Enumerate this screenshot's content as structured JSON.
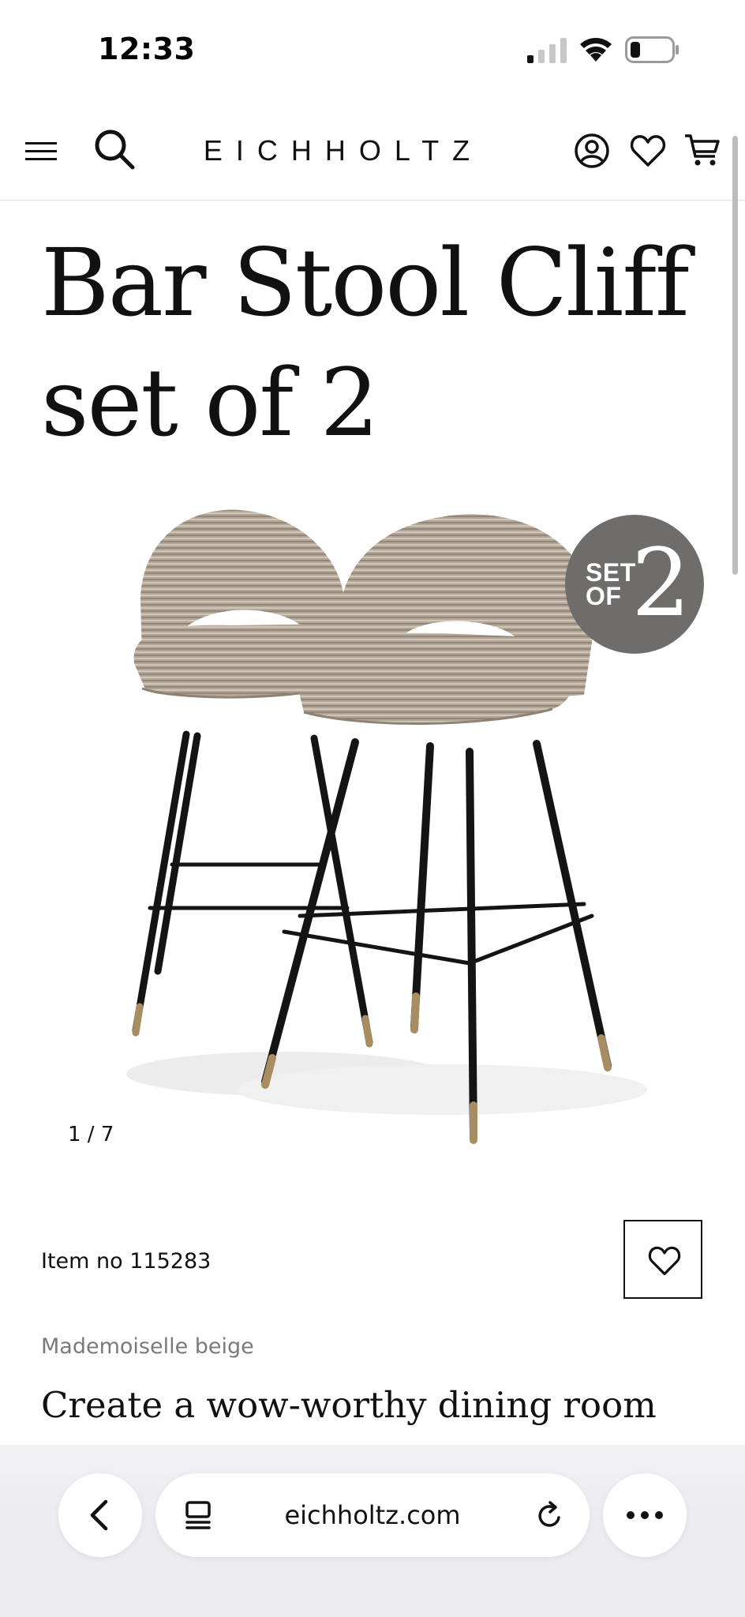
{
  "status_bar": {
    "time": "12:33",
    "signal_icon": "cellular-signal-icon",
    "wifi_icon": "wifi-icon",
    "battery_icon": "battery-low-icon"
  },
  "header": {
    "logo": "EICHHOLTZ",
    "menu_icon": "hamburger-menu-icon",
    "search_icon": "search-icon",
    "account_icon": "user-circle-icon",
    "wishlist_icon": "heart-icon",
    "cart_icon": "cart-icon"
  },
  "product": {
    "title_line1": "Bar Stool Cliff",
    "title_line2": "set of 2",
    "badge_set": "SET",
    "badge_of": "OF",
    "badge_number": "2",
    "slide_current": "1",
    "slide_total": "7",
    "slide_separator": " / ",
    "item_no": "Item no 115283",
    "color": "Mademoiselle beige",
    "description": "Create a wow-worthy dining room"
  },
  "browser": {
    "url": "eichholtz.com",
    "back_icon": "chevron-left-icon",
    "tabs_icon": "tab-overview-icon",
    "reload_icon": "reload-icon",
    "more_icon": "more-dots-icon"
  },
  "colors": {
    "text": "#111111",
    "muted": "#7a7a7a",
    "badge": "#6e6d6b",
    "fabric": "#b3a696",
    "legs": "#141414",
    "brass": "#a88d62",
    "toolbar": "#ececf0"
  }
}
